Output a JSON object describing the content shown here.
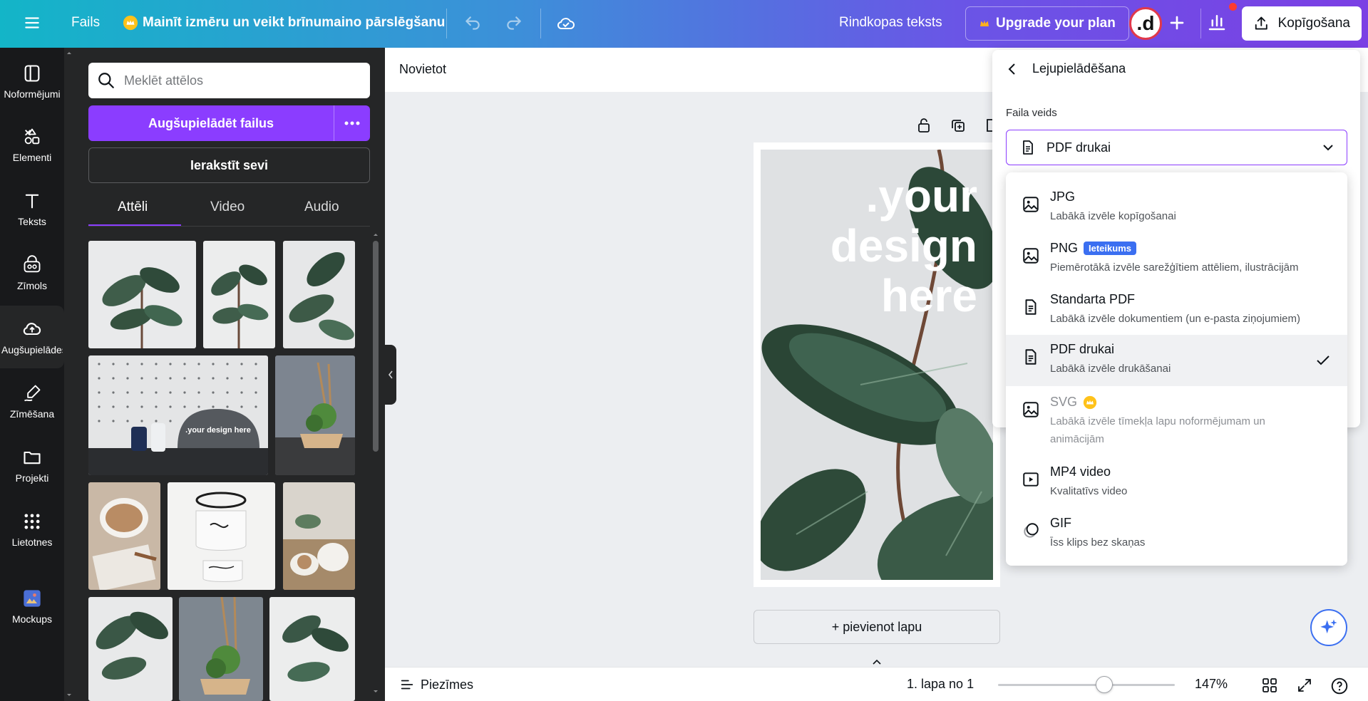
{
  "topbar": {
    "file_menu": "Fails",
    "promo": "Mainīt izmēru un veikt brīnumaino pārslēgšanu",
    "doc_title": "Rindkopas teksts",
    "upgrade": "Upgrade your plan",
    "avatar_letter": ".d",
    "share": "Kopīgošana"
  },
  "rail": {
    "items": [
      {
        "label": "Noformējumi",
        "icon": "layout-icon"
      },
      {
        "label": "Elementi",
        "icon": "shapes-icon"
      },
      {
        "label": "Teksts",
        "icon": "text-icon"
      },
      {
        "label": "Zīmols",
        "icon": "brand-icon"
      },
      {
        "label": "Augšupielādes",
        "icon": "cloud-upload-icon"
      },
      {
        "label": "Zīmēšana",
        "icon": "draw-icon"
      },
      {
        "label": "Projekti",
        "icon": "folder-icon"
      },
      {
        "label": "Lietotnes",
        "icon": "apps-icon"
      },
      {
        "label": "Mockups",
        "icon": "mockups-icon"
      }
    ]
  },
  "panel": {
    "search_placeholder": "Meklēt attēlos",
    "upload_button": "Augšupielādēt failus",
    "record_button": "Ierakstīt sevi",
    "tabs": [
      "Attēli",
      "Video",
      "Audio"
    ],
    "mockup_text": ".your design here"
  },
  "canvas": {
    "header": "Novietot",
    "design_text": [
      ".your",
      "design",
      "here"
    ],
    "add_page": "+ pievienot lapu"
  },
  "footer": {
    "notes": "Piezīmes",
    "page_indicator": "1. lapa no 1",
    "zoom": "147%",
    "zoom_fraction": 0.6
  },
  "download": {
    "title": "Lejupielādēšana",
    "file_type_label": "Faila veids",
    "selected": "PDF drukai",
    "options": [
      {
        "name": "JPG",
        "desc": "Labākā izvēle kopīgošanai",
        "icon": "image-icon"
      },
      {
        "name": "PNG",
        "badge": "Ieteikums",
        "desc": "Piemērotākā izvēle sarežģītiem attēliem, ilustrācijām",
        "icon": "image-icon"
      },
      {
        "name": "Standarta PDF",
        "desc": "Labākā izvēle dokumentiem (un e-pasta ziņojumiem)",
        "icon": "document-icon"
      },
      {
        "name": "PDF drukai",
        "desc": "Labākā izvēle drukāšanai",
        "icon": "document-icon",
        "selected": true
      },
      {
        "name": "SVG",
        "desc": "Labākā izvēle tīmekļa lapu noformējumam un animācijām",
        "icon": "image-icon",
        "premium": true
      },
      {
        "name": "MP4 video",
        "desc": "Kvalitatīvs video",
        "icon": "video-icon"
      },
      {
        "name": "GIF",
        "desc": "Īss klips bez skaņas",
        "icon": "gif-icon"
      }
    ]
  },
  "colors": {
    "accent": "#8b3dff",
    "badge": "#3b6ff1",
    "rail_bg": "#18191b",
    "panel_bg": "#252627"
  }
}
